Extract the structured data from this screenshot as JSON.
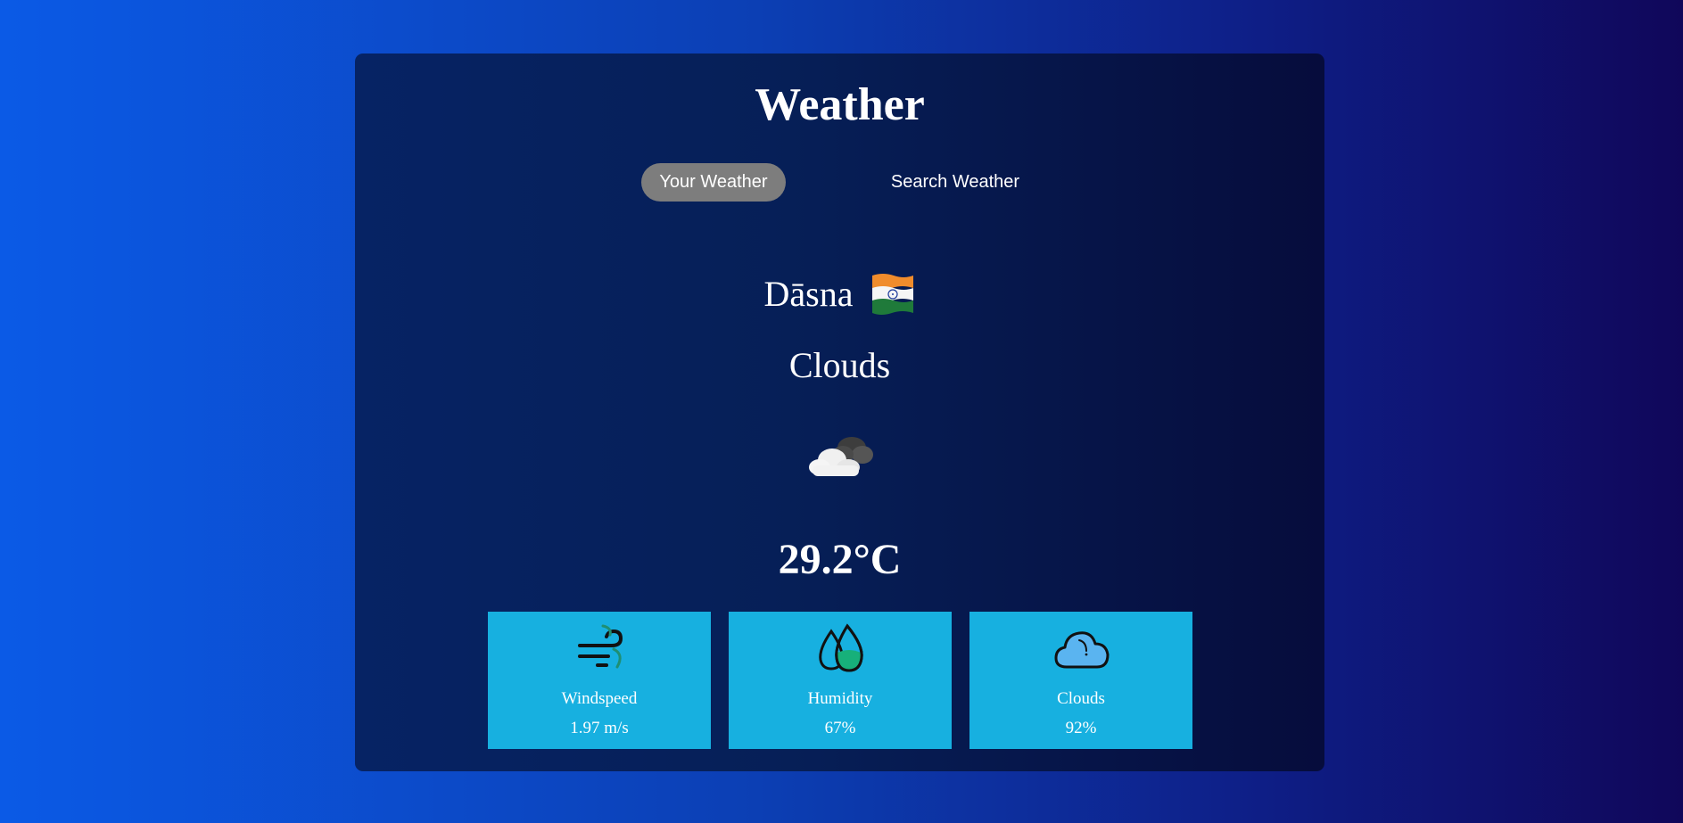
{
  "app": {
    "title": "Weather"
  },
  "tabs": [
    {
      "label": "Your Weather",
      "active": true
    },
    {
      "label": "Search Weather",
      "active": false
    }
  ],
  "location": {
    "city": "Dāsna",
    "flag_icon": "india-flag-icon"
  },
  "weather": {
    "condition": "Clouds",
    "icon": "cloud-icon",
    "temperature": "29.2°C"
  },
  "stats": [
    {
      "label": "Windspeed",
      "value": "1.97 m/s",
      "icon": "wind-icon"
    },
    {
      "label": "Humidity",
      "value": "67%",
      "icon": "humidity-drops-icon"
    },
    {
      "label": "Clouds",
      "value": "92%",
      "icon": "cloud-icon"
    }
  ],
  "colors": {
    "background_start": "#0b5ae6",
    "background_end": "#10075a",
    "card_background": "#062364",
    "active_tab": "#7d7d7d",
    "stat_tile": "#17b0e0",
    "text": "#ffffff"
  }
}
